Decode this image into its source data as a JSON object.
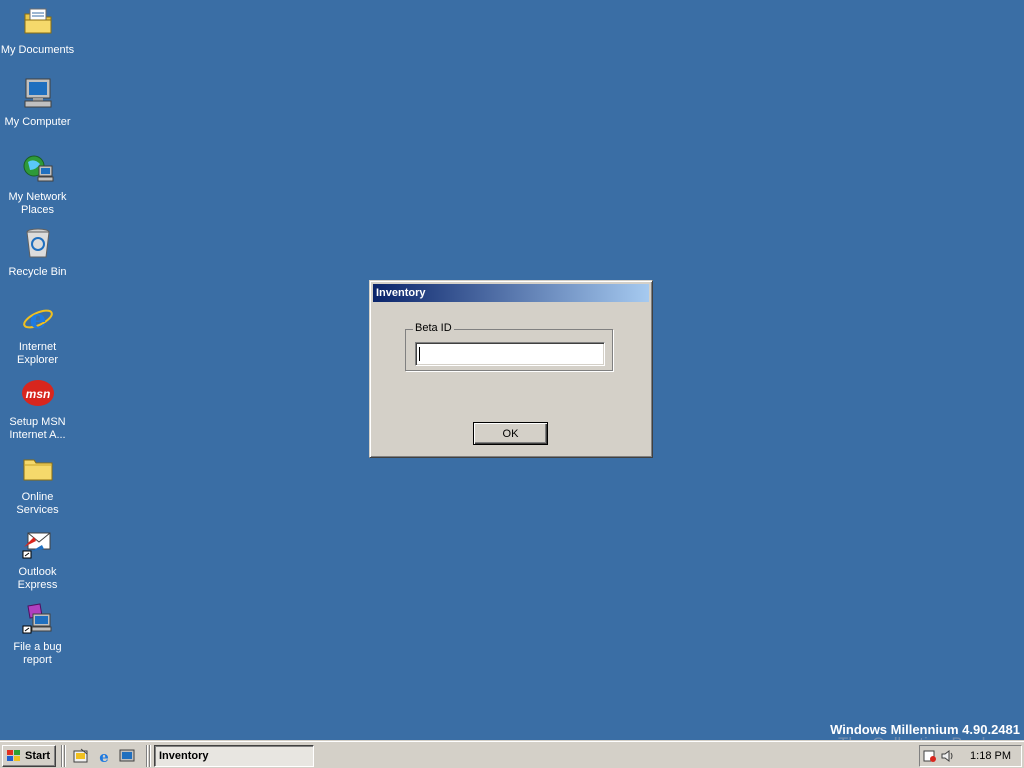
{
  "desktop": {
    "icons": [
      {
        "label": "My Documents"
      },
      {
        "label": "My Computer"
      },
      {
        "label": "My Network Places"
      },
      {
        "label": "Recycle Bin"
      },
      {
        "label": "Internet Explorer"
      },
      {
        "label": "Setup MSN Internet A..."
      },
      {
        "label": "Online Services"
      },
      {
        "label": "Outlook Express"
      },
      {
        "label": "File a bug report"
      }
    ],
    "msn_logo_text": "msn"
  },
  "dialog": {
    "title": "Inventory",
    "group_label": "Beta ID",
    "input_value": "",
    "ok_label": "OK"
  },
  "watermark": {
    "os_version": "Windows Millennium 4.90.2481",
    "collection": "The Collection Book"
  },
  "taskbar": {
    "start_label": "Start",
    "task_label": "Inventory",
    "clock": "1:18 PM"
  },
  "colors": {
    "desktop_bg": "#3a6ea5",
    "titlebar_start": "#0a246a",
    "titlebar_end": "#a6caf0",
    "face": "#d4d0c8"
  }
}
